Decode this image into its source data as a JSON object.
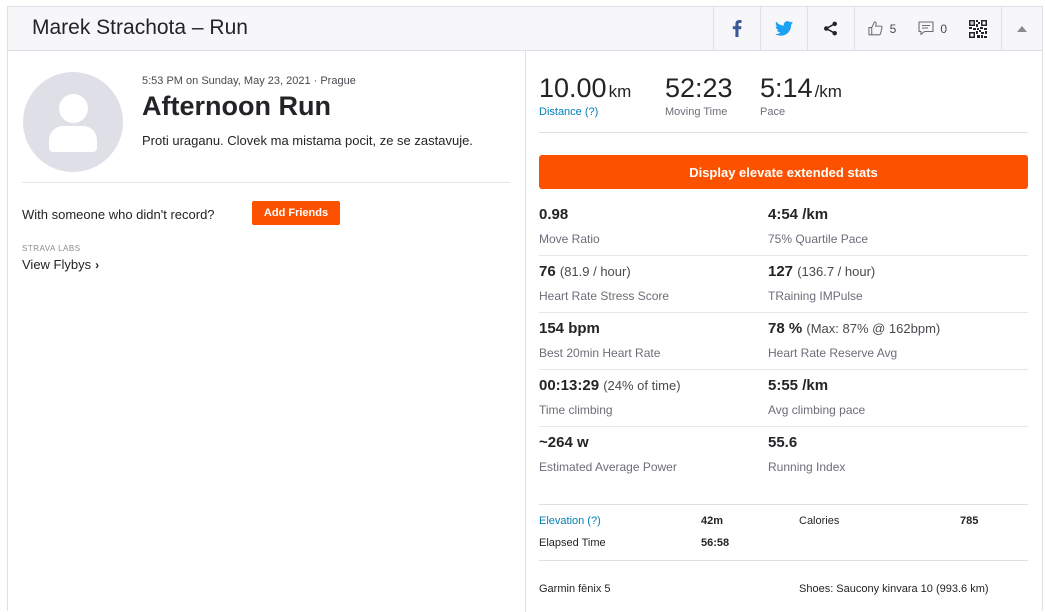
{
  "header": {
    "title": "Marek Strachota – Run",
    "kudos_count": "5",
    "comments_count": "0"
  },
  "activity": {
    "meta": "5:53 PM on Sunday, May 23, 2021 · Prague",
    "title": "Afternoon Run",
    "description": "Proti uraganu. Clovek ma mistama pocit, ze se zastavuje."
  },
  "friends": {
    "prompt": "With someone who didn't record?",
    "add_label": "Add Friends"
  },
  "flybys": {
    "labs": "STRAVA LABS",
    "label": "View Flybys"
  },
  "summary": {
    "distance": {
      "value": "10.00",
      "unit": "km",
      "label": "Distance (?)"
    },
    "moving_time": {
      "value": "52:23",
      "label": "Moving Time"
    },
    "pace": {
      "value": "5:14",
      "unit": "/km",
      "label": "Pace"
    }
  },
  "elevate_button": "Display elevate extended stats",
  "extended_stats": [
    {
      "value": "0.98",
      "extra": "",
      "label": "Move Ratio"
    },
    {
      "value": "4:54 /km",
      "extra": "",
      "label": "75% Quartile Pace"
    },
    {
      "value": "76",
      "extra": "(81.9 / hour)",
      "label": "Heart Rate Stress Score"
    },
    {
      "value": "127",
      "extra": "(136.7 / hour)",
      "label": "TRaining IMPulse"
    },
    {
      "value": "154 bpm",
      "extra": "",
      "label": "Best 20min Heart Rate"
    },
    {
      "value": "78 %",
      "extra": "(Max: 87% @ 162bpm)",
      "label": "Heart Rate Reserve Avg"
    },
    {
      "value": "00:13:29",
      "extra": "(24% of time)",
      "label": "Time climbing"
    },
    {
      "value": "5:55 /km",
      "extra": "",
      "label": "Avg climbing pace"
    },
    {
      "value": "~264 w",
      "extra": "",
      "label": "Estimated Average Power"
    },
    {
      "value": "55.6",
      "extra": "",
      "label": "Running Index"
    }
  ],
  "more_stats": {
    "elevation_label": "Elevation (?)",
    "elevation_value": "42m",
    "calories_label": "Calories",
    "calories_value": "785",
    "elapsed_label": "Elapsed Time",
    "elapsed_value": "56:58"
  },
  "gear": {
    "device": "Garmin fēnix 5",
    "shoes": "Shoes: Saucony kinvara 10 (993.6 km)"
  },
  "colors": {
    "accent": "#fc5200",
    "link": "#007fb6",
    "facebook": "#3b5998",
    "twitter": "#1da1f2"
  },
  "icons": [
    "facebook-icon",
    "twitter-icon",
    "share-icon",
    "kudos-icon",
    "comment-icon",
    "qr-code-icon",
    "chevron-up-icon",
    "avatar-placeholder",
    "chevron-right-icon"
  ]
}
